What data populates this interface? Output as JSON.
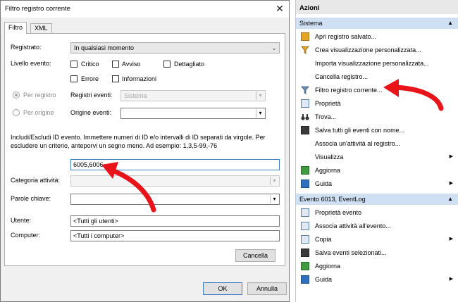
{
  "dialog": {
    "title": "Filtro registro corrente",
    "close_glyph": "✕",
    "tabs": [
      "Filtro",
      "XML"
    ],
    "registrato_label": "Registrato:",
    "registrato_value": "In qualsiasi momento",
    "livello_label": "Livello evento:",
    "levels": [
      "Critico",
      "Avviso",
      "Dettagliato",
      "Errore",
      "Informazioni"
    ],
    "per_registro": "Per registro",
    "per_origine": "Per origine",
    "registri_label": "Registri eventi:",
    "registri_value": "Sistema",
    "origine_label": "Origine eventi:",
    "origine_value": "",
    "description": "Includi/Escludi ID evento. Immettere numeri di ID e/o intervalli di ID separati da virgole. Per escludere un criterio, anteporvi un segno meno. Ad esempio: 1,3,5-99,-76",
    "id_value": "6005,6006",
    "categoria_label": "Categoria attività:",
    "categoria_value": "",
    "parole_label": "Parole chiave:",
    "parole_value": "",
    "utente_label": "Utente:",
    "utente_value": "<Tutti gli utenti>",
    "computer_label": "Computer:",
    "computer_value": "<Tutti i computer>",
    "cancella": "Cancella",
    "ok": "OK",
    "annulla": "Annulla"
  },
  "actions": {
    "header": "Azioni",
    "section1": {
      "title": "Sistema",
      "items": [
        {
          "label": "Apri registro salvato...",
          "icon": "folder-icon"
        },
        {
          "label": "Crea visualizzazione personalizzata...",
          "icon": "filter-icon"
        },
        {
          "label": "Importa visualizzazione personalizzata...",
          "icon": ""
        },
        {
          "label": "Cancella registro...",
          "icon": ""
        },
        {
          "label": "Filtro registro corrente...",
          "icon": "filter-icon"
        },
        {
          "label": "Proprietà",
          "icon": "properties-icon"
        },
        {
          "label": "Trova...",
          "icon": "binoculars-icon"
        },
        {
          "label": "Salva tutti gli eventi con nome...",
          "icon": "save-icon"
        },
        {
          "label": "Associa un'attività al registro...",
          "icon": ""
        },
        {
          "label": "Visualizza",
          "icon": ""
        },
        {
          "label": "Aggiorna",
          "icon": "refresh-icon"
        },
        {
          "label": "Guida",
          "icon": "help-icon"
        }
      ]
    },
    "section2": {
      "title": "Evento 6013, EventLog",
      "items": [
        {
          "label": "Proprietà evento",
          "icon": "properties-icon"
        },
        {
          "label": "Associa attività all'evento...",
          "icon": "task-icon"
        },
        {
          "label": "Copia",
          "icon": "copy-icon"
        },
        {
          "label": "Salva eventi selezionati...",
          "icon": "save-icon"
        },
        {
          "label": "Aggiorna",
          "icon": "refresh-icon"
        },
        {
          "label": "Guida",
          "icon": "help-icon"
        }
      ]
    },
    "submenu_glyph": "▶",
    "collapse_glyph": "▲"
  },
  "colors": {
    "annotation_arrow": "#e8141a",
    "section_header": "#cfe0f4",
    "focus_border": "#3c7fc4"
  }
}
